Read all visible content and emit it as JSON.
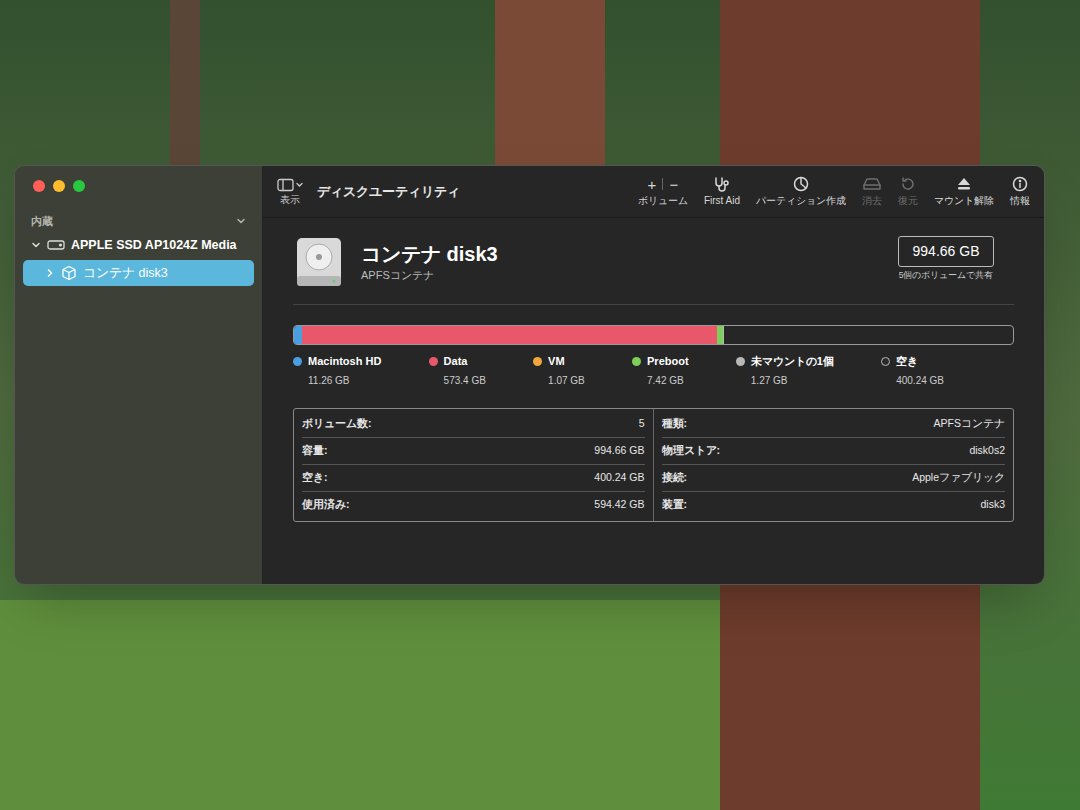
{
  "window": {
    "title": "ディスクユーティリティ"
  },
  "toolbar": {
    "view": {
      "label": "表示"
    },
    "buttons": [
      {
        "kind": "volume",
        "label": "ボリューム",
        "add": "+",
        "remove": "−",
        "disabled": false
      },
      {
        "kind": "firstaid",
        "label": "First Aid",
        "disabled": false
      },
      {
        "kind": "partition",
        "label": "パーティション作成",
        "disabled": false
      },
      {
        "kind": "erase",
        "label": "消去",
        "disabled": true
      },
      {
        "kind": "restore",
        "label": "復元",
        "disabled": true
      },
      {
        "kind": "unmount",
        "label": "マウント解除",
        "disabled": false
      },
      {
        "kind": "info",
        "label": "情報",
        "disabled": false
      }
    ]
  },
  "sidebar": {
    "section": {
      "label": "内蔵",
      "expanded": true
    },
    "disks": [
      {
        "label": "APPLE SSD AP1024Z Media",
        "expanded": true,
        "children": [
          {
            "label": "コンテナ disk3",
            "selected": true,
            "expanded": false
          }
        ]
      }
    ]
  },
  "container": {
    "name": "コンテナ disk3",
    "type": "APFSコンテナ",
    "size": "994.66 GB",
    "shared": "5個のボリュームで共有"
  },
  "usage": {
    "segments": [
      {
        "kind": "segment",
        "name": "Macintosh HD",
        "size": "11.26 GB",
        "level": 0.0113,
        "color": "#4a9fe0"
      },
      {
        "kind": "segment",
        "name": "Data",
        "size": "573.4 GB",
        "level": 0.5765,
        "color": "#e9576a"
      },
      {
        "kind": "segment",
        "name": "VM",
        "size": "1.07 GB",
        "level": 0.0011,
        "color": "#f0a83c"
      },
      {
        "kind": "segment",
        "name": "Preboot",
        "size": "7.42 GB",
        "level": 0.0075,
        "color": "#7ccf5a"
      },
      {
        "kind": "segment",
        "name": "未マウントの1個",
        "size": "1.27 GB",
        "level": 0.0013,
        "color": "#b8b8b8"
      },
      {
        "kind": "free",
        "name": "空き",
        "size": "400.24 GB",
        "level": 0.4024,
        "color": "#2a2a2a"
      }
    ]
  },
  "info": {
    "left": [
      {
        "label": "ボリューム数:",
        "value": "5"
      },
      {
        "label": "容量:",
        "value": "994.66 GB"
      },
      {
        "label": "空き:",
        "value": "400.24 GB"
      },
      {
        "label": "使用済み:",
        "value": "594.42 GB"
      }
    ],
    "right": [
      {
        "label": "種類:",
        "value": "APFSコンテナ"
      },
      {
        "label": "物理ストア:",
        "value": "disk0s2"
      },
      {
        "label": "接続:",
        "value": "Appleファブリック"
      },
      {
        "label": "装置:",
        "value": "disk3"
      }
    ]
  }
}
